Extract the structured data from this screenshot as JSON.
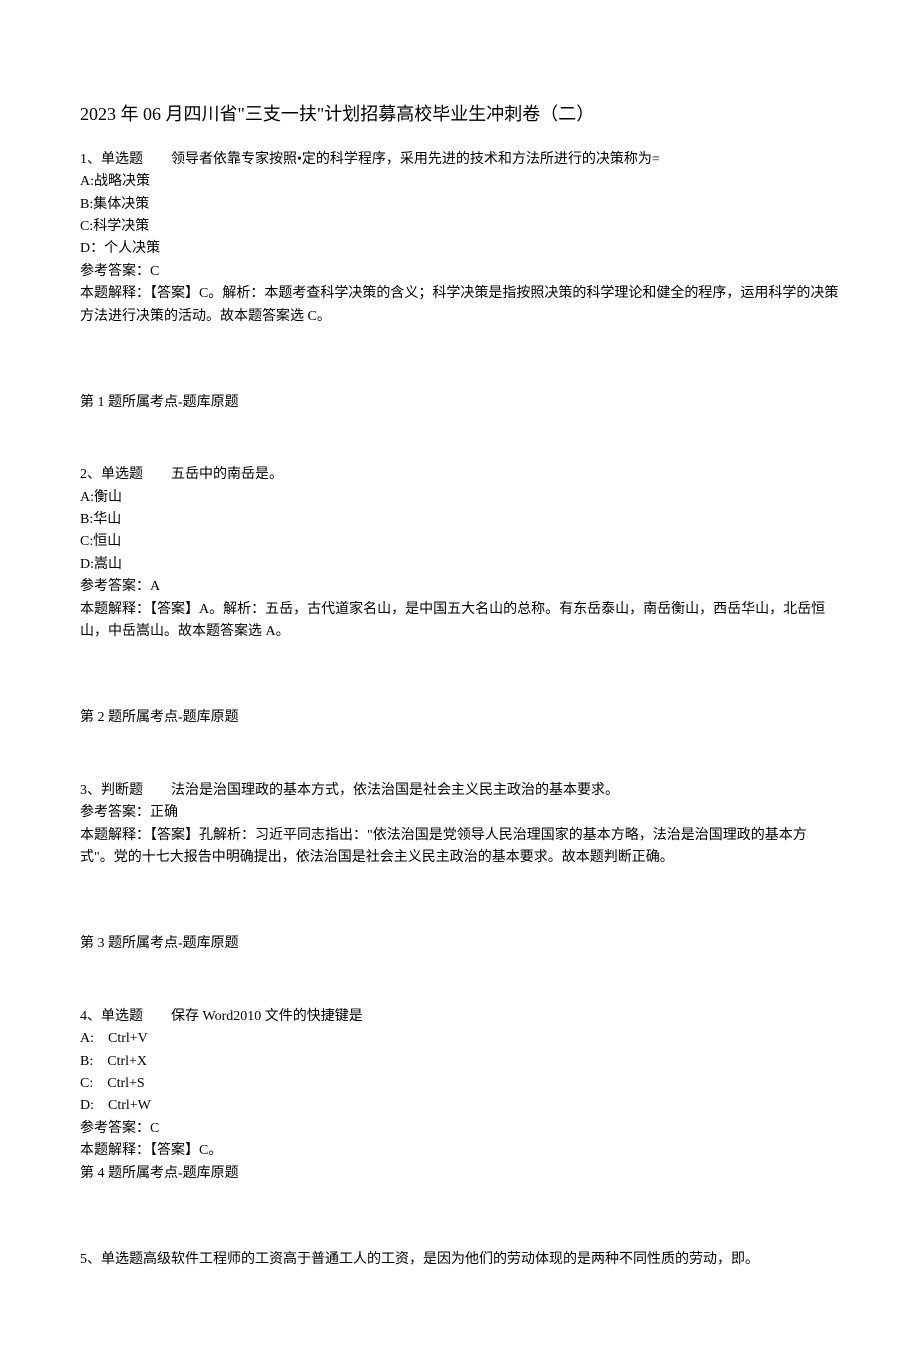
{
  "title": "2023 年 06 月四川省\"三支一扶\"计划招募高校毕业生冲刺卷（二）",
  "q1": {
    "stem": "1、单选题　　领导者依靠专家按照•定的科学程序，采用先进的技术和方法所进行的决策称为=",
    "a": "A:战略决策",
    "b": "B:集体决策",
    "c": "C:科学决策",
    "d": "D：个人决策",
    "ref": "参考答案：C",
    "exp": "本题解释：【答案】C。解析：本题考查科学决策的含义；科学决策是指按照决策的科学理论和健全的程序，运用科学的决策方法进行决策的活动。故本题答案选 C。",
    "src": "第 1 题所属考点-题库原题"
  },
  "q2": {
    "stem": "2、单选题　　五岳中的南岳是。",
    "a": "A:衡山",
    "b": "B:华山",
    "c": "C:恒山",
    "d": "D:嵩山",
    "ref": "参考答案：A",
    "exp": "本题解释：【答案】A。解析：五岳，古代道家名山，是中国五大名山的总称。有东岳泰山，南岳衡山，西岳华山，北岳恒山，中岳嵩山。故本题答案选 A。",
    "src": "第 2 题所属考点-题库原题"
  },
  "q3": {
    "stem": "3、判断题　　法治是治国理政的基本方式，依法治国是社会主义民主政治的基本要求。",
    "ref": "参考答案：正确",
    "exp": "本题解释：【答案】孔解析：习近平同志指出：\"依法治国是党领导人民治理国家的基本方略，法治是治国理政的基本方式\"。党的十七大报告中明确提出，依法治国是社会主义民主政治的基本要求。故本题判断正确。",
    "src": "第 3 题所属考点-题库原题"
  },
  "q4": {
    "stem": "4、单选题　　保存 Word2010 文件的快捷键是",
    "a": "A:　Ctrl+V",
    "b": "B:　Ctrl+X",
    "c": "C:　Ctrl+S",
    "d": "D:　Ctrl+W",
    "ref": "参考答案：C",
    "exp": "本题解释：【答案】C。",
    "src": "第 4 题所属考点-题库原题"
  },
  "q5": {
    "stem": "5、单选题高级软件工程师的工资高于普通工人的工资，是因为他们的劳动体现的是两种不同性质的劳动，即。"
  }
}
